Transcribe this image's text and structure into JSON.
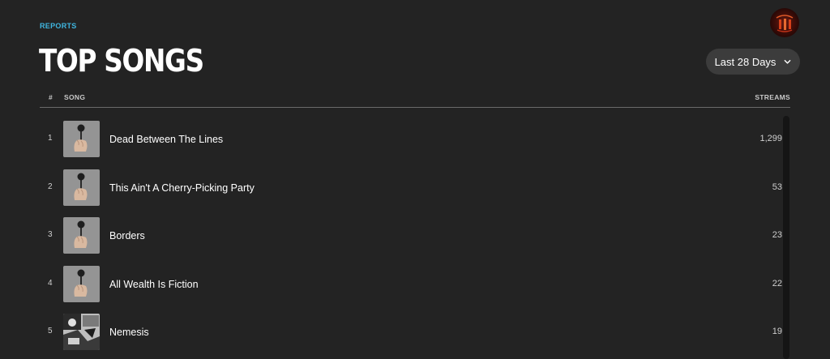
{
  "header": {
    "breadcrumb": "REPORTS",
    "title": "TOP SONGS",
    "range_label": "Last 28 Days"
  },
  "table": {
    "col_num": "#",
    "col_song": "SONG",
    "col_streams": "STREAMS",
    "rows": [
      {
        "rank": "1",
        "title": "Dead Between The Lines",
        "streams": "1,299",
        "art": "hand-mic"
      },
      {
        "rank": "2",
        "title": "This Ain't A Cherry-Picking Party",
        "streams": "53",
        "art": "hand-mic"
      },
      {
        "rank": "3",
        "title": "Borders",
        "streams": "23",
        "art": "hand-mic"
      },
      {
        "rank": "4",
        "title": "All Wealth Is Fiction",
        "streams": "22",
        "art": "hand-mic"
      },
      {
        "rank": "5",
        "title": "Nemesis",
        "streams": "19",
        "art": "bw-collage"
      }
    ]
  },
  "colors": {
    "background": "#232323",
    "accent": "#3fb6e0",
    "pill": "#3c3c3c"
  }
}
